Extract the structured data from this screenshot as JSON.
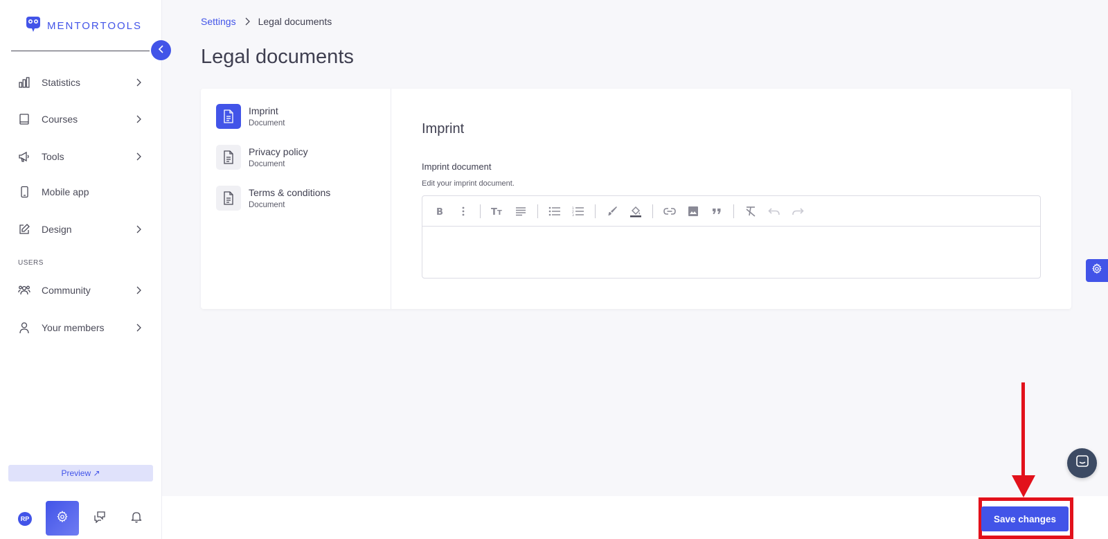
{
  "app": {
    "logo_text": "MENTORTOOLS",
    "accent_color": "#4254e8",
    "annotation_color": "#e2111b"
  },
  "sidebar": {
    "items": [
      {
        "label": "Statistics",
        "icon": "bar-chart-icon",
        "has_chevron": true
      },
      {
        "label": "Courses",
        "icon": "book-icon",
        "has_chevron": true
      },
      {
        "label": "Tools",
        "icon": "megaphone-icon",
        "has_chevron": true
      },
      {
        "label": "Mobile app",
        "icon": "mobile-icon",
        "has_chevron": false
      },
      {
        "label": "Design",
        "icon": "pencil-icon",
        "has_chevron": true
      },
      {
        "label": "Community",
        "icon": "community-icon",
        "has_chevron": true
      },
      {
        "label": "Your members",
        "icon": "user-icon",
        "has_chevron": true
      }
    ],
    "section_users": "USERS",
    "preview_label": "Preview ↗",
    "avatar_initials": "RP"
  },
  "breadcrumb": {
    "parent": "Settings",
    "current": "Legal documents"
  },
  "page_title": "Legal documents",
  "documents": [
    {
      "title": "Imprint",
      "subtitle": "Document",
      "active": true
    },
    {
      "title": "Privacy policy",
      "subtitle": "Document",
      "active": false
    },
    {
      "title": "Terms & conditions",
      "subtitle": "Document",
      "active": false
    }
  ],
  "editor": {
    "heading": "Imprint",
    "field_label": "Imprint document",
    "field_help": "Edit your imprint document.",
    "content": "",
    "toolbar": [
      "bold",
      "more",
      "text-size",
      "align",
      "bullet-list",
      "numbered-list",
      "brush",
      "fill-color",
      "link",
      "image",
      "quote",
      "clear-format",
      "undo",
      "redo"
    ]
  },
  "footer": {
    "save_label": "Save changes"
  }
}
